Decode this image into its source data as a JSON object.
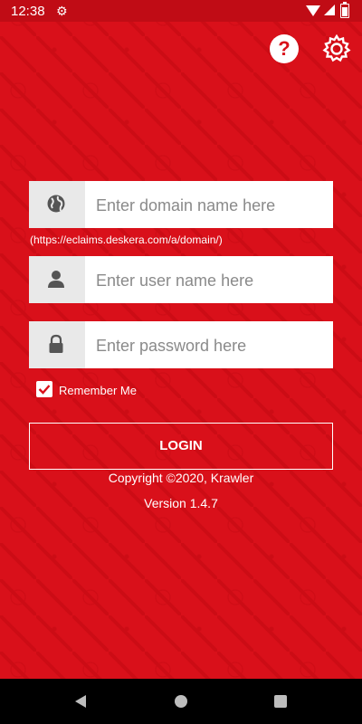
{
  "status_bar": {
    "time": "12:38"
  },
  "colors": {
    "background": "#d9101a",
    "field_bg": "#ffffff",
    "icon_box_bg": "#e9e9e9"
  },
  "icons": {
    "help": "question-circle-icon",
    "settings": "gear-icon",
    "domain": "globe-icon",
    "user": "person-icon",
    "password": "lock-icon"
  },
  "form": {
    "domain_placeholder": "Enter domain name here",
    "domain_hint": "(https://eclaims.deskera.com/a/domain/)",
    "username_placeholder": "Enter user name here",
    "password_placeholder": "Enter password here",
    "remember_label": "Remember Me",
    "remember_checked": true,
    "login_label": "LOGIN"
  },
  "footer": {
    "copyright": "Copyright ©2020, Krawler",
    "version": "Version 1.4.7"
  }
}
